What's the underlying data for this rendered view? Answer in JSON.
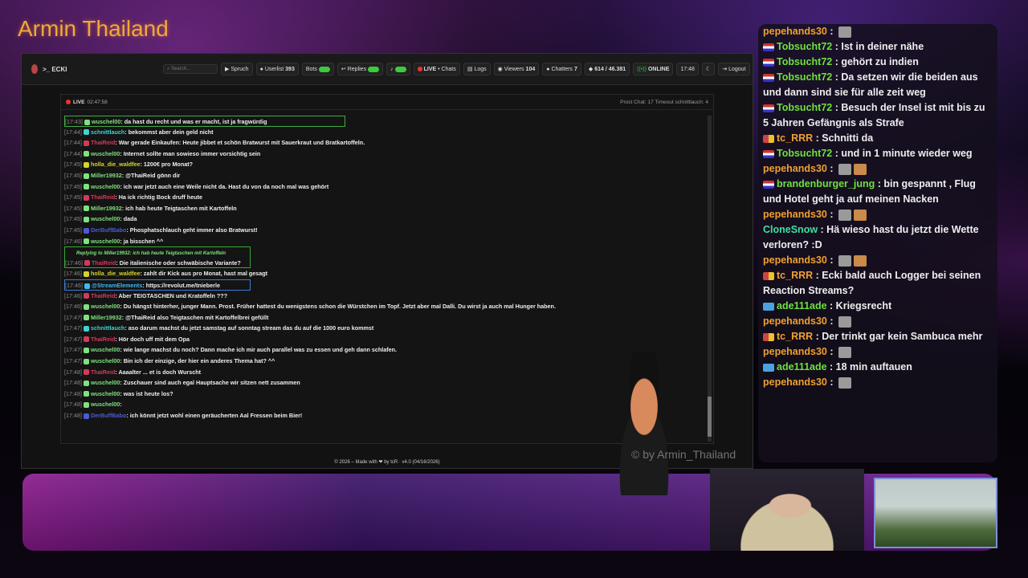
{
  "overlay": {
    "title": "Armin Thailand",
    "watermark": "© by Armin_Thailand"
  },
  "app": {
    "brand": ">_ ECKI",
    "search_placeholder": "Search...",
    "toolbar": [
      {
        "id": "spruch",
        "label": "Spruch"
      },
      {
        "id": "userlist",
        "label": "Userlist",
        "count": "393"
      },
      {
        "id": "bots",
        "label": "Bots"
      },
      {
        "id": "replies",
        "label": "Replies"
      },
      {
        "id": "live",
        "label": "LIVE",
        "suffix": "• Chats"
      },
      {
        "id": "logs",
        "label": "Logs"
      },
      {
        "id": "viewers",
        "label": "Viewers",
        "count": "104"
      },
      {
        "id": "chatters",
        "label": "Chatters",
        "count": "7"
      },
      {
        "id": "msgs",
        "label": "614 / 46.381"
      },
      {
        "id": "online",
        "label": "ONLINE"
      },
      {
        "id": "time",
        "label": "17:48"
      },
      {
        "id": "logout",
        "label": "Logout"
      }
    ],
    "live": {
      "label": "LIVE",
      "time": "02:47:58",
      "stats": "Prost Chat: 17   Timeout schnittlauch: 4"
    },
    "footer": "© 2026 – Made with ❤ by tcR · v4.0 (04/16/2026)"
  },
  "messages": [
    {
      "t": "[17:43]",
      "u": "wuschel00",
      "c": "#7fe27f",
      "m": "da hast du recht und was er macht, ist ja fragwürdig",
      "box": "hl"
    },
    {
      "t": "[17:44]",
      "u": "schnittlauch",
      "c": "#3fd3d3",
      "m": "bekommst aber dein geld nicht"
    },
    {
      "t": "[17:44]",
      "u": "ThaiReid",
      "c": "#d33a5a",
      "m": "War gerade Einkaufen: Heute jibbet et schön Bratwurst mit Sauerkraut und Bratkartoffeln."
    },
    {
      "t": "[17:44]",
      "u": "wuschel00",
      "c": "#7fe27f",
      "m": "Internet sollte man sowieso immer vorsichtig sein"
    },
    {
      "t": "[17:45]",
      "u": "holla_die_waldfee",
      "c": "#d4d42a",
      "m": "1200€ pro Monat?"
    },
    {
      "t": "[17:45]",
      "u": "Miller19932",
      "c": "#7fe27f",
      "m": "@ThaiReid gönn dir"
    },
    {
      "t": "[17:45]",
      "u": "wuschel00",
      "c": "#7fe27f",
      "m": "ich war jetzt auch eine Weile nicht da. Hast du von da noch mal was gehört"
    },
    {
      "t": "[17:45]",
      "u": "ThaiReid",
      "c": "#d33a5a",
      "m": "Ha ick richtig Bock druff heute"
    },
    {
      "t": "[17:45]",
      "u": "Miller19932",
      "c": "#7fe27f",
      "m": "ich hab heute Teigtaschen mit Kartoffeln"
    },
    {
      "t": "[17:45]",
      "u": "wuschel00",
      "c": "#7fe27f",
      "m": "dada"
    },
    {
      "t": "[17:45]",
      "u": "DerBuffBabo",
      "c": "#4a5bd9",
      "m": "Phosphatschlauch geht immer also Bratwurst!"
    },
    {
      "t": "[17:46]",
      "u": "wuschel00",
      "c": "#7fe27f",
      "m": "ja bisschen ^^"
    },
    {
      "t": "",
      "u": "",
      "c": "#7fe27f",
      "m": "Replying to Miller19932: ich hab heute Teigtaschen mit Kartoffeln",
      "box": "replyhead"
    },
    {
      "t": "[17:46]",
      "u": "ThaiReid",
      "c": "#d33a5a",
      "m": "Die italienische oder schwäbische Variante?",
      "box": "replybody"
    },
    {
      "t": "[17:46]",
      "u": "holla_die_waldfee",
      "c": "#d4d42a",
      "m": "zahlt dir Kick aus pro Monat, hast mal gesagt"
    },
    {
      "t": "[17:46]",
      "u": "@StreamElements",
      "c": "#3fb8f0",
      "m": "https://revolut.me/tnieberle",
      "box": "link"
    },
    {
      "t": "[17:46]",
      "u": "ThaiReid",
      "c": "#d33a5a",
      "m": "Aber TEIGTASCHEN und Kratoffeln ???"
    },
    {
      "t": "[17:46]",
      "u": "wuschel00",
      "c": "#7fe27f",
      "m": "Du hängst hinterher, junger Mann. Prost. Früher hattest du wenigstens schon die Würstchen im Topf. Jetzt aber mal Dalli. Du wirst ja auch mal Hunger haben."
    },
    {
      "t": "[17:47]",
      "u": "Miller19932",
      "c": "#7fe27f",
      "m": "@ThaiReid also Teigtaschen mit Kartoffelbrei gefüllt"
    },
    {
      "t": "[17:47]",
      "u": "schnittlauch",
      "c": "#3fd3d3",
      "m": "aso darum machst du jetzt samstag auf sonntag stream das du auf die 1000 euro kommst"
    },
    {
      "t": "[17:47]",
      "u": "ThaiReid",
      "c": "#d33a5a",
      "m": "Hör doch uff mit dem Opa"
    },
    {
      "t": "[17:47]",
      "u": "wuschel00",
      "c": "#7fe27f",
      "m": "wie lange machst du noch? Dann mache ich mir auch parallel was zu essen und geh dann schlafen."
    },
    {
      "t": "[17:47]",
      "u": "wuschel00",
      "c": "#7fe27f",
      "m": "Bin ich der einzige, der hier ein anderes Thema hat? ^^"
    },
    {
      "t": "[17:48]",
      "u": "ThaiReid",
      "c": "#d33a5a",
      "m": "Aaaalter ... et is doch Wurscht"
    },
    {
      "t": "[17:48]",
      "u": "wuschel00",
      "c": "#7fe27f",
      "m": "Zuschauer sind auch egal Hauptsache wir sitzen nett zusammen"
    },
    {
      "t": "[17:48]",
      "u": "wuschel00",
      "c": "#7fe27f",
      "m": "was ist heute los?"
    },
    {
      "t": "[17:48]",
      "u": "wuschel00",
      "c": "#7fe27f",
      "m": ""
    },
    {
      "t": "[17:48]",
      "u": "DerBuffBabo",
      "c": "#4a5bd9",
      "m": "ich könnt jetzt wohl einen geräucherten Aal Fressen beim Bier!"
    }
  ],
  "side_chat": [
    {
      "u": "pepehands30",
      "c": "#f0a030",
      "m": "",
      "emotes": 1
    },
    {
      "u": "Tobsucht72",
      "c": "#6fe03f",
      "m": "Ist in deiner nähe"
    },
    {
      "u": "Tobsucht72",
      "c": "#6fe03f",
      "m": "gehört zu indien"
    },
    {
      "u": "Tobsucht72",
      "c": "#6fe03f",
      "m": "Da setzen wir die beiden aus und dann sind sie für alle zeit weg"
    },
    {
      "u": "Tobsucht72",
      "c": "#6fe03f",
      "m": "Besuch der Insel ist mit bis zu 5 Jahren Gefängnis als Strafe"
    },
    {
      "u": "tc_RRR",
      "c": "#f0a030",
      "m": "Schnitti da"
    },
    {
      "u": "Tobsucht72",
      "c": "#6fe03f",
      "m": "und in 1 minute wieder weg"
    },
    {
      "u": "pepehands30",
      "c": "#f0a030",
      "m": "",
      "emotes": 2
    },
    {
      "u": "brandenburger_jung",
      "c": "#6fe03f",
      "m": "bin gespannt , Flug und Hotel geht ja auf meinen Nacken"
    },
    {
      "u": "pepehands30",
      "c": "#f0a030",
      "m": "",
      "emotes": 2
    },
    {
      "u": "CloneSnow",
      "c": "#3fe0a0",
      "m": "Hä wieso hast du jetzt die Wette verloren? :D"
    },
    {
      "u": "pepehands30",
      "c": "#f0a030",
      "m": "",
      "emotes": 2
    },
    {
      "u": "tc_RRR",
      "c": "#f0a030",
      "m": "Ecki bald auch Logger bei seinen Reaction Streams?"
    },
    {
      "u": "ade111ade",
      "c": "#6fe03f",
      "m": "Kriegsrecht"
    },
    {
      "u": "pepehands30",
      "c": "#f0a030",
      "m": "",
      "emotes": 1
    },
    {
      "u": "tc_RRR",
      "c": "#f0a030",
      "m": "Der trinkt gar kein Sambuca mehr"
    },
    {
      "u": "pepehands30",
      "c": "#f0a030",
      "m": "",
      "emotes": 1
    },
    {
      "u": "ade111ade",
      "c": "#6fe03f",
      "m": "18 min auftauen"
    },
    {
      "u": "pepehands30",
      "c": "#f0a030",
      "m": "",
      "emotes": 1
    }
  ]
}
